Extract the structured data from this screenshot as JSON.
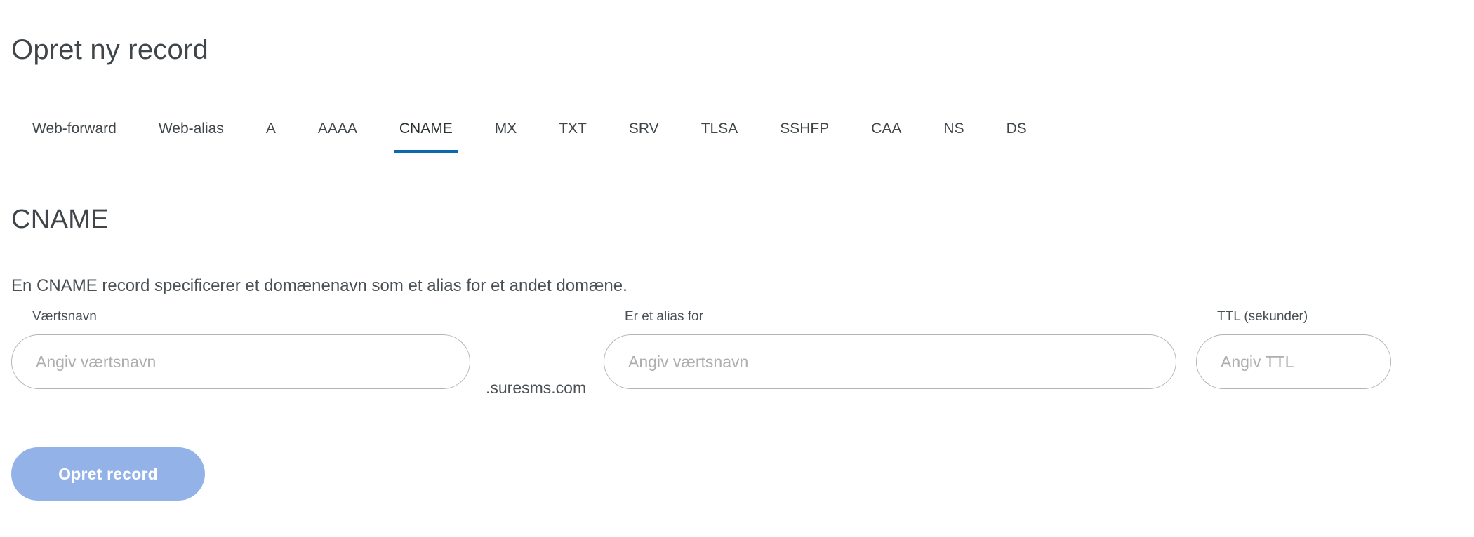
{
  "header": {
    "title": "Opret ny record"
  },
  "tabs": {
    "active": "CNAME",
    "items": [
      {
        "label": "Web-forward"
      },
      {
        "label": "Web-alias"
      },
      {
        "label": "A"
      },
      {
        "label": "AAAA"
      },
      {
        "label": "CNAME"
      },
      {
        "label": "MX"
      },
      {
        "label": "TXT"
      },
      {
        "label": "SRV"
      },
      {
        "label": "TLSA"
      },
      {
        "label": "SSHFP"
      },
      {
        "label": "CAA"
      },
      {
        "label": "NS"
      },
      {
        "label": "DS"
      }
    ]
  },
  "section": {
    "heading": "CNAME",
    "description": "En CNAME record specificerer et domænenavn som et alias for et andet domæne."
  },
  "form": {
    "hostname": {
      "label": "Værtsnavn",
      "placeholder": "Angiv værtsnavn",
      "value": ""
    },
    "domain_suffix": ".suresms.com",
    "alias": {
      "label": "Er et alias for",
      "placeholder": "Angiv værtsnavn",
      "value": ""
    },
    "ttl": {
      "label": "TTL (sekunder)",
      "placeholder": "Angiv TTL",
      "value": ""
    },
    "submit_label": "Opret record"
  },
  "colors": {
    "accent_blue": "#0a6aad",
    "button_blue": "#93b2e8",
    "divider": "#e6e6e6",
    "input_border": "#b4b4b4",
    "placeholder": "#aeaeae",
    "text": "#3f4549"
  }
}
